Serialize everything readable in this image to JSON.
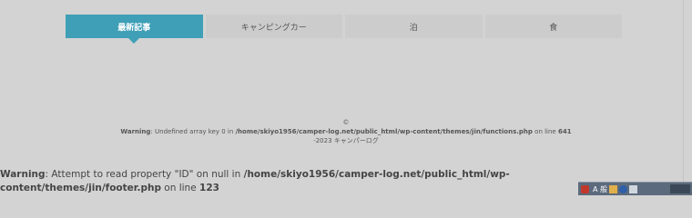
{
  "tabs": [
    {
      "label": "最新記事",
      "active": true
    },
    {
      "label": "キャンピングカー",
      "active": false
    },
    {
      "label": "泊",
      "active": false
    },
    {
      "label": "食",
      "active": false
    }
  ],
  "footer": {
    "copyright_symbol": "©",
    "warning_label": "Warning",
    "warning_message": ": Undefined array key 0 in ",
    "warning_path": "/home/skiyo1956/camper-log.net/public_html/wp-content/themes/jin/functions.php",
    "warning_line_text": " on line ",
    "warning_line": "641",
    "copyright_text": "-2023  キャンパーログ"
  },
  "page_warning": {
    "label": "Warning",
    "message": ": Attempt to read property \"ID\" on null in ",
    "path": "/home/skiyo1956/camper-log.net/public_html/wp-content/themes/jin/footer.php",
    "line_text": " on line ",
    "line": "123"
  },
  "taskbar": {
    "language_indicator": "A 般",
    "icons": [
      "shield-icon",
      "language-icon",
      "ime-icon",
      "help-icon",
      "network-icon",
      "volume-icon"
    ]
  },
  "colors": {
    "background": "#d3d3d3",
    "tab_active": "#3f9fb7",
    "tab_inactive": "#cccccc",
    "taskbar": "#5c6a7d"
  }
}
